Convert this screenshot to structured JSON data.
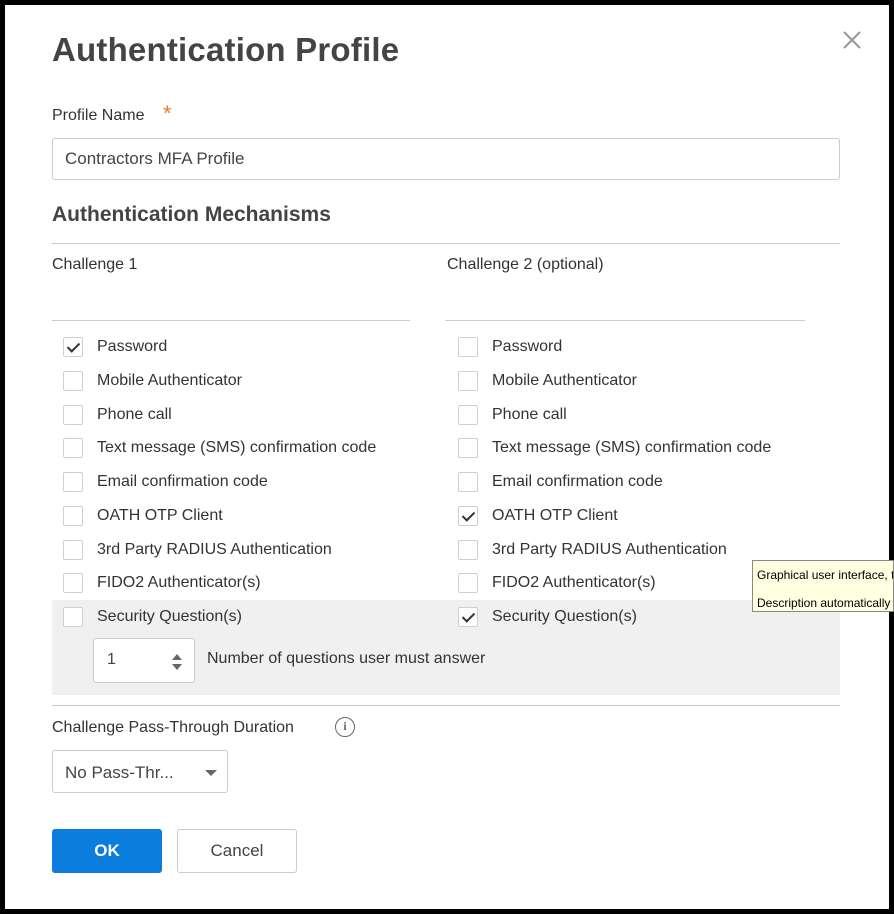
{
  "dialog": {
    "title": "Authentication Profile",
    "close_icon": "close-icon",
    "accent_color": "#0b7ddd",
    "required_color": "#f07b1e"
  },
  "profile": {
    "label": "Profile Name",
    "required_mark": "*",
    "value": "Contractors MFA Profile"
  },
  "mechanisms": {
    "title": "Authentication Mechanisms",
    "challenge1": {
      "heading": "Challenge 1",
      "options": [
        {
          "label": "Password",
          "checked": true
        },
        {
          "label": "Mobile Authenticator",
          "checked": false
        },
        {
          "label": "Phone call",
          "checked": false
        },
        {
          "label": "Text message (SMS) confirmation code",
          "checked": false
        },
        {
          "label": "Email confirmation code",
          "checked": false
        },
        {
          "label": "OATH OTP Client",
          "checked": false
        },
        {
          "label": "3rd Party RADIUS Authentication",
          "checked": false
        },
        {
          "label": "FIDO2 Authenticator(s)",
          "checked": false
        },
        {
          "label": "Security Question(s)",
          "checked": false
        }
      ]
    },
    "challenge2": {
      "heading": "Challenge 2 (optional)",
      "options": [
        {
          "label": "Password",
          "checked": false
        },
        {
          "label": "Mobile Authenticator",
          "checked": false
        },
        {
          "label": "Phone call",
          "checked": false
        },
        {
          "label": "Text message (SMS) confirmation code",
          "checked": false
        },
        {
          "label": "Email confirmation code",
          "checked": false
        },
        {
          "label": "OATH OTP Client",
          "checked": true
        },
        {
          "label": "3rd Party RADIUS Authentication",
          "checked": false
        },
        {
          "label": "FIDO2 Authenticator(s)",
          "checked": false
        },
        {
          "label": "Security Question(s)",
          "checked": true
        }
      ]
    },
    "questions": {
      "value": "1",
      "label": "Number of questions user must answer"
    }
  },
  "pass_through": {
    "label": "Challenge Pass-Through Duration",
    "info_icon": "info-icon",
    "selected": "No Pass-Thr..."
  },
  "buttons": {
    "ok": "OK",
    "cancel": "Cancel"
  },
  "tooltip": {
    "line1": "Graphical user interface, t",
    "line2": "Description automatically"
  }
}
